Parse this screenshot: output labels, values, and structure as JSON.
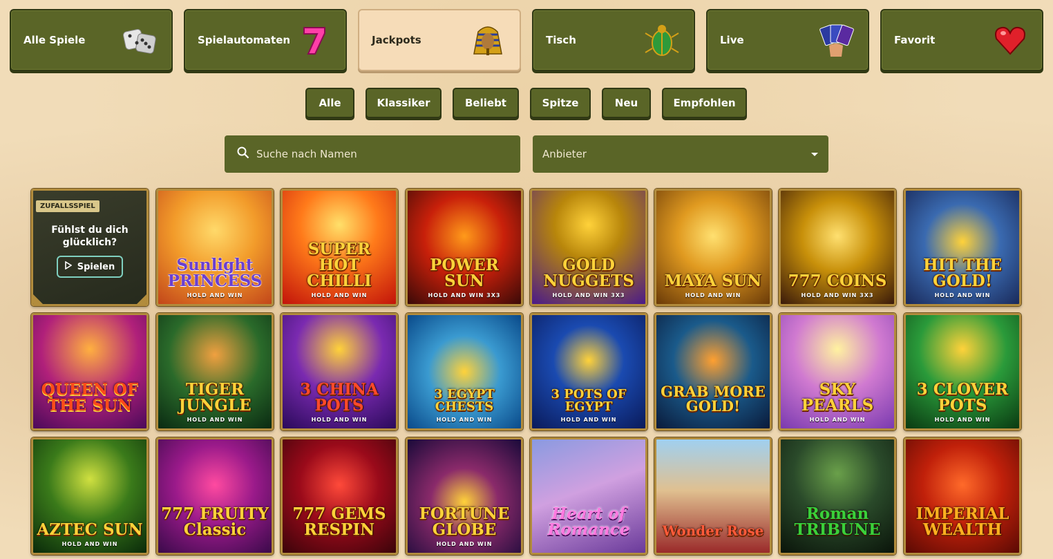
{
  "categories": [
    {
      "label": "Alle Spiele",
      "icon": "dice-icon",
      "active": false
    },
    {
      "label": "Spielautomaten",
      "icon": "lucky-seven-icon",
      "active": false
    },
    {
      "label": "Jackpots",
      "icon": "pharaoh-icon",
      "active": true
    },
    {
      "label": "Tisch",
      "icon": "scarab-icon",
      "active": false
    },
    {
      "label": "Live",
      "icon": "cards-hand-icon",
      "active": false
    },
    {
      "label": "Favorit",
      "icon": "heart-icon",
      "active": false
    }
  ],
  "filters": [
    "Alle",
    "Klassiker",
    "Beliebt",
    "Spitze",
    "Neu",
    "Empfohlen"
  ],
  "search": {
    "placeholder": "Suche nach Namen"
  },
  "provider": {
    "label": "Anbieter"
  },
  "random_game": {
    "badge": "ZUFALLSSPIEL",
    "question": "Fühlst du dich glücklich?",
    "play_label": "Spielen"
  },
  "games": [
    {
      "title": "Sunlight PRINCESS",
      "sub": "HOLD AND WIN"
    },
    {
      "title": "SUPER HOT CHILLI",
      "sub": "HOLD AND WIN"
    },
    {
      "title": "POWER SUN",
      "sub": "HOLD AND WIN 3X3"
    },
    {
      "title": "GOLD NUGGETS",
      "sub": "HOLD AND WIN 3X3"
    },
    {
      "title": "MAYA SUN",
      "sub": "HOLD AND WIN"
    },
    {
      "title": "777 COINS",
      "sub": "HOLD AND WIN 3X3"
    },
    {
      "title": "HIT THE GOLD!",
      "sub": "HOLD AND WIN"
    },
    {
      "title": "QUEEN OF THE SUN",
      "sub": ""
    },
    {
      "title": "TIGER JUNGLE",
      "sub": "HOLD AND WIN"
    },
    {
      "title": "3 CHINA POTS",
      "sub": "HOLD AND WIN"
    },
    {
      "title": "3 EGYPT CHESTS",
      "sub": "HOLD AND WIN"
    },
    {
      "title": "3 POTS OF EGYPT",
      "sub": "HOLD AND WIN"
    },
    {
      "title": "GRAB MORE GOLD!",
      "sub": ""
    },
    {
      "title": "SKY PEARLS",
      "sub": "HOLD AND WIN"
    },
    {
      "title": "3 CLOVER POTS",
      "sub": "HOLD AND WIN"
    },
    {
      "title": "AZTEC SUN",
      "sub": "HOLD AND WIN"
    },
    {
      "title": "777 FRUITY Classic",
      "sub": ""
    },
    {
      "title": "777 GEMS RESPIN",
      "sub": ""
    },
    {
      "title": "FORTUNE GLOBE",
      "sub": "HOLD AND WIN"
    },
    {
      "title": "Heart of Romance",
      "sub": ""
    },
    {
      "title": "Wonder Rose",
      "sub": ""
    },
    {
      "title": "Roman TRIBUNE",
      "sub": ""
    },
    {
      "title": "IMPERIAL WEALTH",
      "sub": ""
    }
  ],
  "colors": {
    "button_green": "#5a6527",
    "active_tab": "#f6dcb8",
    "tile_border": "#b28c3d"
  }
}
